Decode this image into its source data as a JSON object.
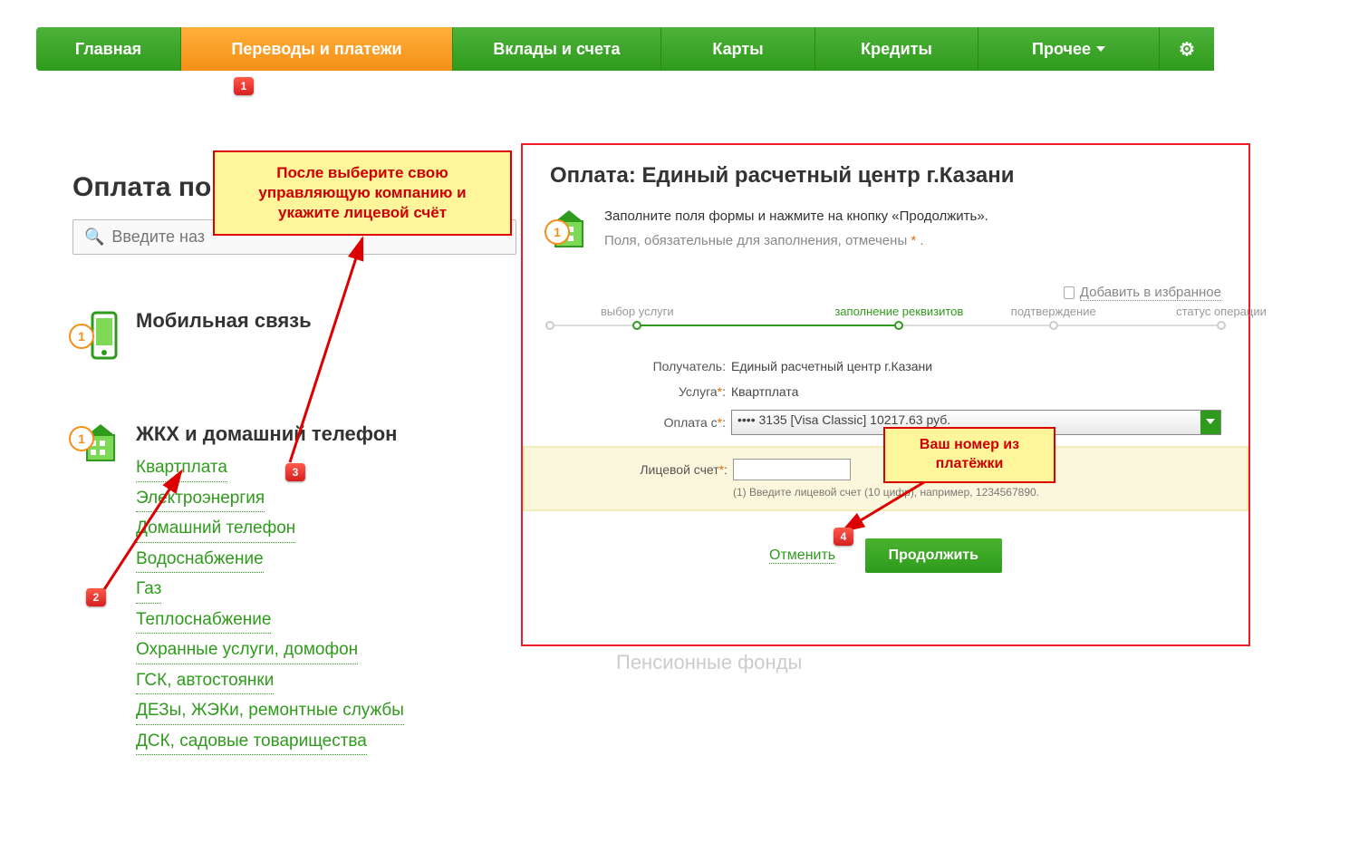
{
  "nav": {
    "items": [
      "Главная",
      "Переводы и платежи",
      "Вклады и счета",
      "Карты",
      "Кредиты",
      "Прочее"
    ]
  },
  "left": {
    "title": "Оплата по",
    "search_placeholder": "Введите наз",
    "mobile_title": "Мобильная связь",
    "zkh_title": "ЖКХ и домашний телефон",
    "links": [
      "Квартплата",
      "Электроэнергия",
      "Домашний телефон",
      "Водоснабжение",
      "Газ",
      "Теплоснабжение",
      "Охранные услуги, домофон",
      "ГСК, автостоянки",
      "ДЕЗы, ЖЭКи, ремонтные службы",
      "ДСК, садовые товарищества"
    ]
  },
  "fade_behind": "Пенсионные фонды",
  "panel": {
    "title": "Оплата: Единый расчетный центр г.Казани",
    "info1": "Заполните поля формы и нажмите на кнопку «Продолжить».",
    "info2_a": "Поля, обязательные для заполнения, отмечены ",
    "info2_b": " .",
    "fav": "Добавить в избранное",
    "steps": [
      "выбор услуги",
      "заполнение реквизитов",
      "подтверждение",
      "статус операции"
    ],
    "recipient_label": "Получатель:",
    "recipient": "Единый расчетный центр г.Казани",
    "service_label": "Услуга",
    "service": "Квартплата",
    "pay_from_label": "Оплата с",
    "pay_from": "•••• 3135 [Visa Classic] 10217.63 руб.",
    "acct_label": "Лицевой счет",
    "acct_hint": "(1) Введите лицевой счет (10 цифр), например, 1234567890.",
    "cancel": "Отменить",
    "continue": "Продолжить"
  },
  "callouts": {
    "c1": "После выберите свою управляющую компанию и укажите лицевой счёт",
    "c2": "Ваш номер из платёжки"
  },
  "markers": {
    "m1": "1",
    "m2": "2",
    "m3": "3",
    "m4": "4"
  }
}
